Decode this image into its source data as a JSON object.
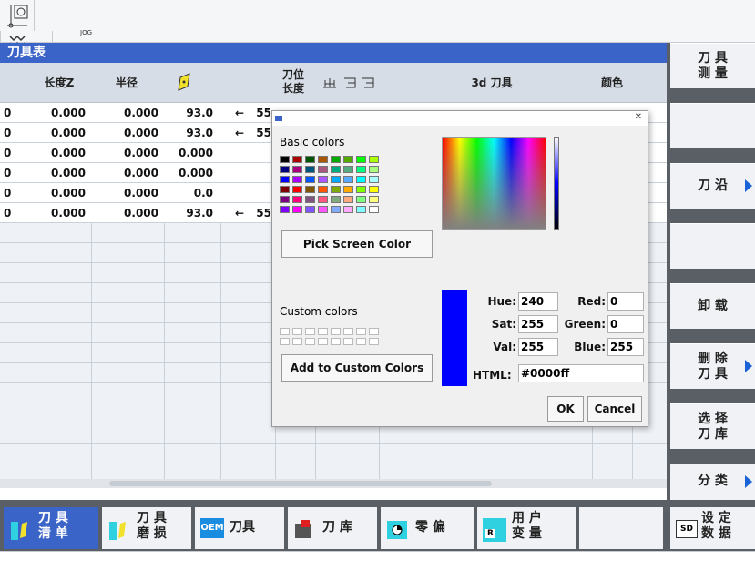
{
  "topbar": {
    "jog_label": "JOG"
  },
  "window": {
    "title": "刀具表"
  },
  "table": {
    "columns": [
      "长度Z",
      "半径",
      "",
      "刀位\n长度",
      "",
      "",
      "",
      "3d 刀具",
      "颜色"
    ],
    "col_length": "长度Z",
    "col_radius": "半径",
    "col_pos_line1": "刀位",
    "col_pos_line2": "长度",
    "col_3d": "3d 刀具",
    "col_color": "颜色",
    "rows": [
      {
        "prefix": "0",
        "len": "0.000",
        "rad": "0.000",
        "angle": "93.0",
        "arrow": "←",
        "pos": "55"
      },
      {
        "prefix": "0",
        "len": "0.000",
        "rad": "0.000",
        "angle": "93.0",
        "arrow": "←",
        "pos": "55"
      },
      {
        "prefix": "0",
        "len": "0.000",
        "rad": "0.000",
        "angle": "0.000",
        "arrow": "",
        "pos": ""
      },
      {
        "prefix": "0",
        "len": "0.000",
        "rad": "0.000",
        "angle": "0.000",
        "arrow": "",
        "pos": ""
      },
      {
        "prefix": "0",
        "len": "0.000",
        "rad": "0.000",
        "angle": "0.0",
        "arrow": "",
        "pos": ""
      },
      {
        "prefix": "0",
        "len": "0.000",
        "rad": "0.000",
        "angle": "93.0",
        "arrow": "←",
        "pos": "55"
      }
    ]
  },
  "dialog": {
    "basic_colors_label": "Basic colors",
    "pick_screen_color": "Pick Screen Color",
    "custom_colors_label": "Custom colors",
    "add_custom": "Add to Custom Colors",
    "hue_label": "Hue:",
    "hue": "240",
    "sat_label": "Sat:",
    "sat": "255",
    "val_label": "Val:",
    "val": "255",
    "red_label": "Red:",
    "red": "0",
    "green_label": "Green:",
    "green": "0",
    "blue_label": "Blue:",
    "blue": "255",
    "html_label": "HTML:",
    "html": "#0000ff",
    "ok": "OK",
    "cancel": "Cancel",
    "current_color": "#0000ff",
    "basic_palette": [
      "#000000",
      "#aa0000",
      "#005500",
      "#aa5500",
      "#00aa00",
      "#55aa00",
      "#00ff00",
      "#aaff00",
      "#00007f",
      "#aa007f",
      "#00557f",
      "#aa557f",
      "#00aa7f",
      "#55aa7f",
      "#00ff7f",
      "#aaff7f",
      "#0000ff",
      "#aa00ff",
      "#0055ff",
      "#aa55ff",
      "#00aaff",
      "#55aaff",
      "#00ffff",
      "#aaffff",
      "#7f0000",
      "#ff0000",
      "#7f5500",
      "#ff5500",
      "#7faa00",
      "#ffaa00",
      "#7fff00",
      "#ffff00",
      "#7f007f",
      "#ff007f",
      "#7f557f",
      "#ff557f",
      "#7faa7f",
      "#ffaa7f",
      "#7fff7f",
      "#ffff7f",
      "#7f00ff",
      "#ff00ff",
      "#7f55ff",
      "#ff55ff",
      "#7faaff",
      "#ffaaff",
      "#7fffff",
      "#ffffff"
    ]
  },
  "softkeys": {
    "sk1_l1": "刀 具",
    "sk1_l2": "测 量",
    "sk3": "刀 沿",
    "sk5": "卸 载",
    "sk6_l1": "删 除",
    "sk6_l2": "刀 具",
    "sk7_l1": "选 择",
    "sk7_l2": "刀 库",
    "sk8": "分 类"
  },
  "bottomkeys": {
    "b1_l1": "刀 具",
    "b1_l2": "清 单",
    "b2_l1": "刀 具",
    "b2_l2": "磨 损",
    "b3_oem": "OEM",
    "b3": "刀具",
    "b4": "刀 库",
    "b5": "零 偏",
    "b6_l1": "用 户",
    "b6_l2": "变 量",
    "b6_icon": "R",
    "b8_l1": "设 定",
    "b8_l2": "数 据",
    "b8_icon": "SD"
  }
}
